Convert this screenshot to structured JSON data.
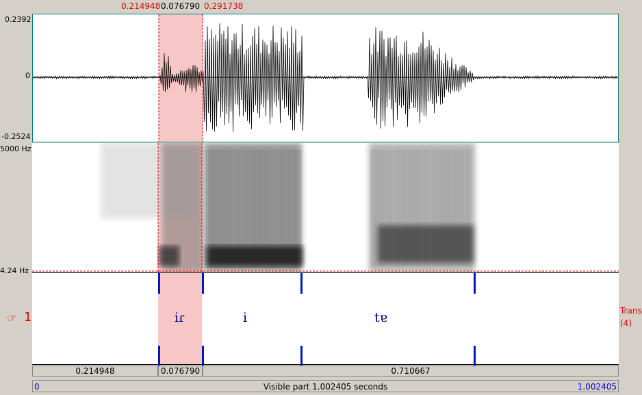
{
  "selection": {
    "start": "0.214948",
    "duration": "0.076790",
    "end": "0.291738"
  },
  "waveform": {
    "ymax": "0.2392",
    "yzero": "0",
    "ymin": "-0.2524"
  },
  "spectrogram": {
    "fmax": "5000 Hz",
    "fmin": "4.24 Hz"
  },
  "tier": {
    "number": "1",
    "name": "Trans",
    "count": "(4)",
    "labels": [
      "iɾ",
      "i",
      "tɐ"
    ]
  },
  "intervals": {
    "first": "0.214948",
    "second": "0.076790",
    "third": "0.710667"
  },
  "status": {
    "left": "0",
    "visible": "Visible part 1.002405 seconds",
    "right": "1.002405"
  },
  "colors": {
    "selection": "#f7c6c6",
    "boundary": "#0018b8",
    "label": "#000080"
  }
}
